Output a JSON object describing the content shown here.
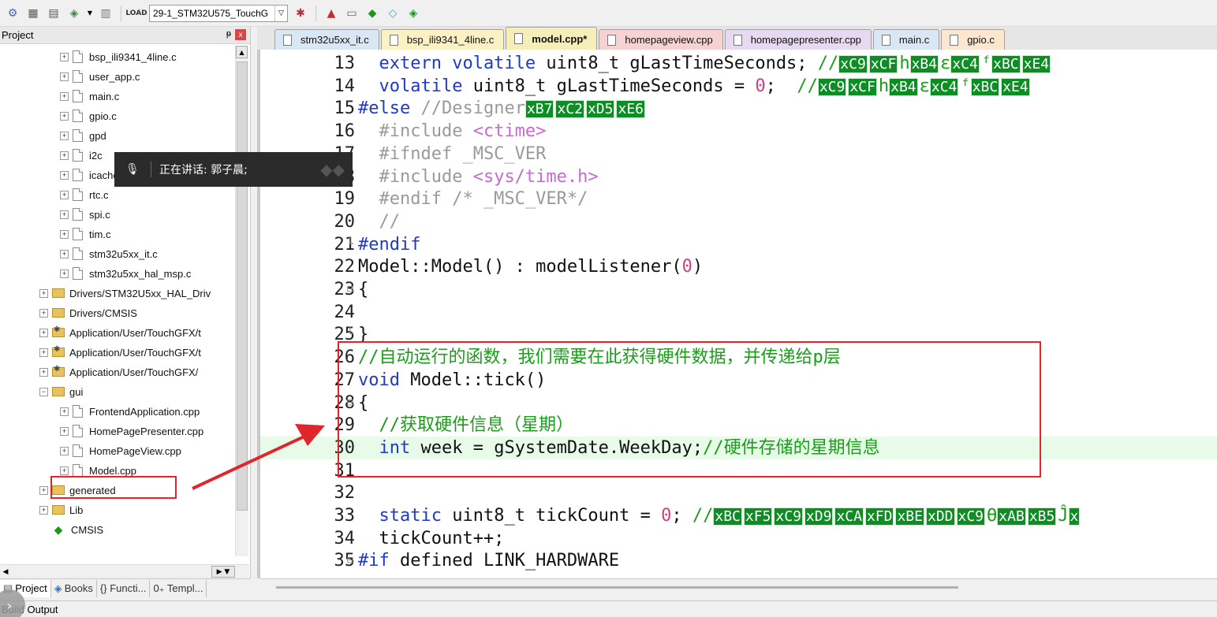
{
  "toolbar": {
    "target": "29-1_STM32U575_TouchG",
    "icons": [
      "pack-installer-icon",
      "manage-project-icon",
      "manage-components-icon",
      "select-software-packs-icon",
      "rebuild-icon",
      "load-download-icon",
      "target-options-icon",
      "magic-wand-icon",
      "manage-run-time-icon",
      "layers-icon",
      "green-diamond-icon",
      "compare-icon",
      "settings-icon"
    ]
  },
  "project_panel": {
    "title": "Project",
    "pin_label": "ᵽ",
    "close_label": "x",
    "tree": [
      {
        "label": "bsp_ili9341_4line.c",
        "type": "file"
      },
      {
        "label": "user_app.c",
        "type": "file"
      },
      {
        "label": "main.c",
        "type": "file"
      },
      {
        "label": "gpio.c",
        "type": "file"
      },
      {
        "label": "gpd",
        "type": "file"
      },
      {
        "label": "i2c",
        "type": "file"
      },
      {
        "label": "icache.c",
        "type": "file"
      },
      {
        "label": "rtc.c",
        "type": "file"
      },
      {
        "label": "spi.c",
        "type": "file"
      },
      {
        "label": "tim.c",
        "type": "file"
      },
      {
        "label": "stm32u5xx_it.c",
        "type": "file"
      },
      {
        "label": "stm32u5xx_hal_msp.c",
        "type": "file"
      },
      {
        "label": "Drivers/STM32U5xx_HAL_Driv",
        "type": "folder"
      },
      {
        "label": "Drivers/CMSIS",
        "type": "folder"
      },
      {
        "label": "Application/User/TouchGFX/t",
        "type": "folder-gear"
      },
      {
        "label": "Application/User/TouchGFX/t",
        "type": "folder-gear"
      },
      {
        "label": "Application/User/TouchGFX/",
        "type": "folder-gear"
      },
      {
        "label": "gui",
        "type": "folder-open"
      },
      {
        "label": "FrontendApplication.cpp",
        "type": "file"
      },
      {
        "label": "HomePagePresenter.cpp",
        "type": "file"
      },
      {
        "label": "HomePageView.cpp",
        "type": "file"
      },
      {
        "label": "Model.cpp",
        "type": "file"
      },
      {
        "label": "generated",
        "type": "folder"
      },
      {
        "label": "Lib",
        "type": "folder"
      },
      {
        "label": "CMSIS",
        "type": "component"
      }
    ]
  },
  "panel_tabs": [
    {
      "label": "Project",
      "active": true
    },
    {
      "label": "Books",
      "active": false
    },
    {
      "label": "{} Functi...",
      "active": false
    },
    {
      "label": "0₊ Templ...",
      "active": false
    }
  ],
  "build_output_label": "Build Output",
  "editor_tabs": [
    {
      "label": "stm32u5xx_it.c"
    },
    {
      "label": "bsp_ili9341_4line.c"
    },
    {
      "label": "model.cpp*"
    },
    {
      "label": "homepageview.cpp"
    },
    {
      "label": "homepagepresenter.cpp"
    },
    {
      "label": "main.c"
    },
    {
      "label": "gpio.c"
    }
  ],
  "voice_overlay": {
    "text": "正在讲话:   郭子晨;"
  },
  "code_lines": [
    {
      "n": "13",
      "fold": "",
      "segs": [
        [
          "kw",
          "  extern volatile "
        ],
        [
          "plain",
          "uint8_t gLastTimeSeconds; "
        ],
        [
          "cm",
          "//"
        ],
        [
          "hex",
          "xC9"
        ],
        [
          "hex",
          "xCF"
        ],
        [
          "cm",
          "h"
        ],
        [
          "hex",
          "xB4"
        ],
        [
          "cm",
          "ε"
        ],
        [
          "hex",
          "xC4"
        ],
        [
          "cm",
          "ᶠ"
        ],
        [
          "hex",
          "xBC"
        ],
        [
          "hex",
          "xE4"
        ]
      ]
    },
    {
      "n": "14",
      "fold": "",
      "segs": [
        [
          "kw",
          "  volatile "
        ],
        [
          "plain",
          "uint8_t gLastTimeSeconds = "
        ],
        [
          "num",
          "0"
        ],
        [
          "plain",
          ";  "
        ],
        [
          "cm",
          "//"
        ],
        [
          "hex",
          "xC9"
        ],
        [
          "hex",
          "xCF"
        ],
        [
          "cm",
          "h"
        ],
        [
          "hex",
          "xB4"
        ],
        [
          "cm",
          "ε"
        ],
        [
          "hex",
          "xC4"
        ],
        [
          "cm",
          "ᶠ"
        ],
        [
          "hex",
          "xBC"
        ],
        [
          "hex",
          "xE4"
        ]
      ]
    },
    {
      "n": "15",
      "fold": "",
      "segs": [
        [
          "pp",
          "#else "
        ],
        [
          "cmd",
          "//Designer"
        ],
        [
          "hex",
          "xB7"
        ],
        [
          "hex",
          "xC2"
        ],
        [
          "hex",
          "xD5"
        ],
        [
          "hex",
          "xE6"
        ]
      ]
    },
    {
      "n": "16",
      "fold": "",
      "segs": [
        [
          "cmd",
          "  #include "
        ],
        [
          "str",
          "<ctime>"
        ]
      ]
    },
    {
      "n": "17",
      "fold": "",
      "segs": [
        [
          "cmd",
          "  #ifndef _MSC_VER"
        ]
      ]
    },
    {
      "n": "18",
      "fold": "",
      "segs": [
        [
          "cmd",
          "  #include "
        ],
        [
          "str",
          "<sys/time.h>"
        ]
      ]
    },
    {
      "n": "19",
      "fold": "",
      "segs": [
        [
          "cmd",
          "  #endif /* _MSC_VER*/"
        ]
      ]
    },
    {
      "n": "20",
      "fold": "",
      "segs": [
        [
          "cmd",
          "  //"
        ]
      ]
    },
    {
      "n": "21",
      "fold": "└",
      "segs": [
        [
          "pp",
          "#endif"
        ]
      ]
    },
    {
      "n": "22",
      "fold": "",
      "segs": [
        [
          "plain",
          "Model::Model() : modelListener("
        ],
        [
          "num",
          "0"
        ],
        [
          "plain",
          ")"
        ]
      ]
    },
    {
      "n": "23",
      "fold": "⊟",
      "segs": [
        [
          "plain",
          "{"
        ]
      ]
    },
    {
      "n": "24",
      "fold": "",
      "segs": []
    },
    {
      "n": "25",
      "fold": "└",
      "segs": [
        [
          "plain",
          "}"
        ]
      ]
    },
    {
      "n": "26",
      "fold": "",
      "segs": [
        [
          "cm",
          "//自动运行的函数，我们需要在此获得硬件数据，并传递给p层"
        ]
      ]
    },
    {
      "n": "27",
      "fold": "",
      "segs": [
        [
          "kw",
          "void "
        ],
        [
          "plain",
          "Model::tick()"
        ]
      ]
    },
    {
      "n": "28",
      "fold": "⊟",
      "segs": [
        [
          "plain",
          "{"
        ]
      ]
    },
    {
      "n": "29",
      "fold": "",
      "segs": [
        [
          "cm",
          "  //获取硬件信息（星期）"
        ]
      ]
    },
    {
      "n": "30",
      "fold": "",
      "hl": true,
      "segs": [
        [
          "kw",
          "  int "
        ],
        [
          "plain",
          "week = gSystemDate.WeekDay;"
        ],
        [
          "cm",
          "//硬件存储的星期信息"
        ]
      ]
    },
    {
      "n": "31",
      "fold": "",
      "segs": []
    },
    {
      "n": "32",
      "fold": "",
      "segs": []
    },
    {
      "n": "33",
      "fold": "",
      "segs": [
        [
          "kw",
          "  static "
        ],
        [
          "plain",
          "uint8_t tickCount = "
        ],
        [
          "num",
          "0"
        ],
        [
          "plain",
          "; "
        ],
        [
          "cm",
          "//"
        ],
        [
          "hex",
          "xBC"
        ],
        [
          "hex",
          "xF5"
        ],
        [
          "hex",
          "xC9"
        ],
        [
          "hex",
          "xD9"
        ],
        [
          "hex",
          "xCA"
        ],
        [
          "hex",
          "xFD"
        ],
        [
          "hex",
          "xBE"
        ],
        [
          "hex",
          "xDD"
        ],
        [
          "hex",
          "xC9"
        ],
        [
          "cm",
          "ϴ"
        ],
        [
          "hex",
          "xAB"
        ],
        [
          "hex",
          "xB5"
        ],
        [
          "cm",
          "Ĵ"
        ],
        [
          "hex",
          "x"
        ]
      ]
    },
    {
      "n": "34",
      "fold": "",
      "segs": [
        [
          "plain",
          "  tickCount++;"
        ]
      ]
    },
    {
      "n": "35",
      "fold": "⊟",
      "segs": [
        [
          "pp",
          "#if "
        ],
        [
          "plain",
          "defined LINK_HARDWARE"
        ]
      ]
    }
  ]
}
